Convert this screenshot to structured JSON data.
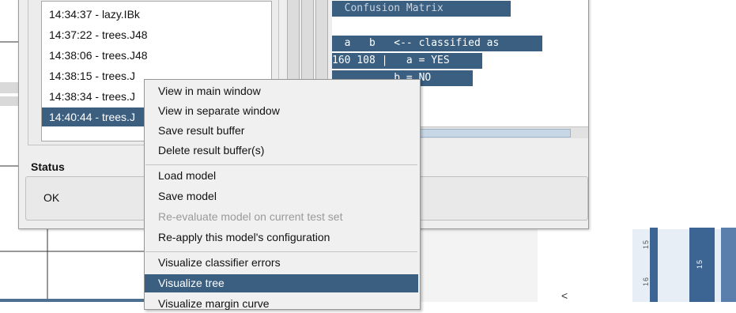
{
  "results_list": {
    "items": [
      "14:34:37 - lazy.IBk",
      "14:37:22 - trees.J48",
      "14:38:06 - trees.J48",
      "14:38:15 - trees.J",
      "14:38:34 - trees.J",
      "14:40:44 - trees.J"
    ],
    "selected_index": 5
  },
  "output": {
    "lines": [
      "  Confusion Matrix",
      "  a   b   <-- classified as",
      "160 108 |   a = YES",
      "          b = NO"
    ]
  },
  "status": {
    "label": "Status",
    "text": "OK"
  },
  "context_menu": {
    "items": [
      {
        "label": "View in main window",
        "state": "normal"
      },
      {
        "label": "View in separate window",
        "state": "normal"
      },
      {
        "label": "Save result buffer",
        "state": "normal"
      },
      {
        "label": "Delete result buffer(s)",
        "state": "normal"
      },
      {
        "label": "Load model",
        "state": "normal"
      },
      {
        "label": "Save model",
        "state": "normal"
      },
      {
        "label": "Re-evaluate model on current test set",
        "state": "disabled"
      },
      {
        "label": "Re-apply this model's configuration",
        "state": "normal"
      },
      {
        "label": "Visualize classifier errors",
        "state": "normal"
      },
      {
        "label": "Visualize tree",
        "state": "highlighted"
      },
      {
        "label": "Visualize margin curve",
        "state": "normal"
      }
    ]
  },
  "document": {
    "ruler_labels": [
      "15",
      "16",
      "15"
    ],
    "scroll_arrow": "<"
  },
  "colors": {
    "selection": "#3c5f80",
    "menu_background": "#f0f0f0",
    "disabled_text": "#9a9a9a"
  }
}
